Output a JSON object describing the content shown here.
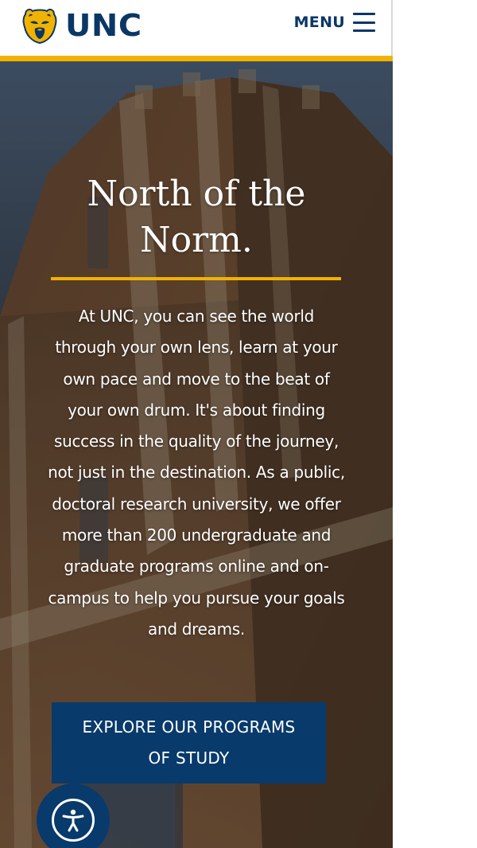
{
  "header": {
    "logo_text": "UNC",
    "logo_icon": "bear-logo-icon",
    "menu_label": "MENU",
    "menu_icon": "hamburger-menu-icon"
  },
  "hero": {
    "title_line1": "North of the",
    "title_line2": "Norm.",
    "body": "At UNC, you can see the world through your own lens, learn at your own pace and move to the beat of your own drum. It's about finding success in the quality of the journey, not just in the destination. As a public, doctoral research university, we offer more than 200 undergraduate and graduate programs online and on-campus to help you pursue your goals and dreams.",
    "cta_line1": "EXPLORE OUR PROGRAMS",
    "cta_line2": "OF STUDY"
  },
  "accessibility": {
    "icon": "accessibility-icon"
  },
  "colors": {
    "brand_navy": "#0a3766",
    "accent_gold": "#f2b200",
    "button_navy": "#083a6b"
  }
}
